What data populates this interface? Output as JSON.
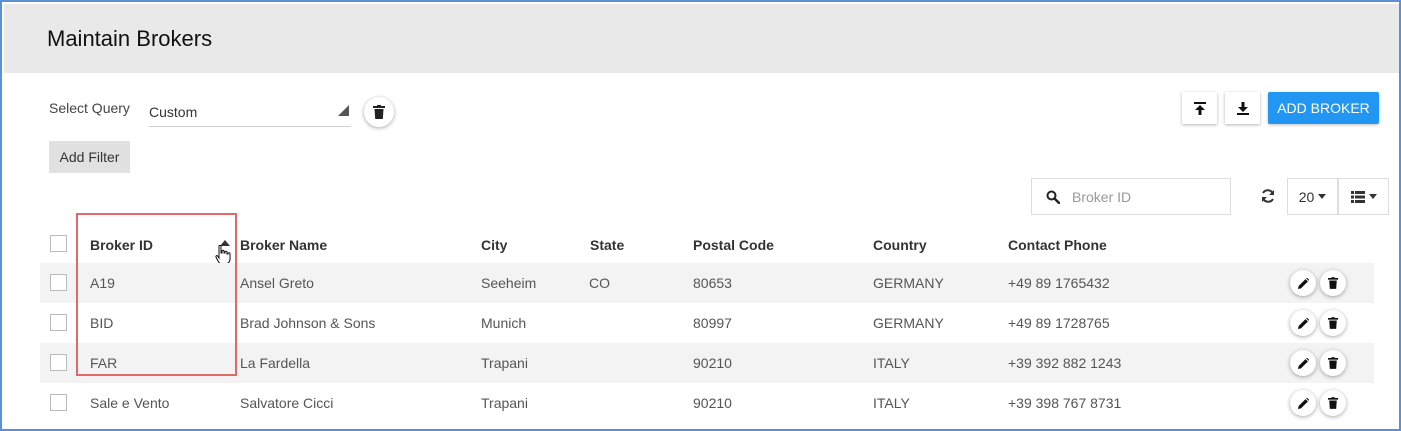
{
  "page": {
    "title": "Maintain Brokers"
  },
  "query": {
    "label": "Select Query",
    "value": "Custom"
  },
  "toolbar": {
    "add_filter_label": "Add Filter",
    "add_broker_label": "ADD BROKER"
  },
  "search": {
    "placeholder": "Broker ID",
    "value": ""
  },
  "pagination": {
    "page_size": "20"
  },
  "table": {
    "columns": [
      "Broker ID",
      "Broker Name",
      "City",
      "State",
      "Postal Code",
      "Country",
      "Contact Phone"
    ],
    "sort": {
      "column": "Broker ID",
      "direction": "ascending"
    },
    "rows": [
      {
        "broker_id": "A19",
        "broker_name": "Ansel Greto",
        "city": "Seeheim",
        "state": "CO",
        "postal_code": "80653",
        "country": "GERMANY",
        "phone": "+49 89 1765432"
      },
      {
        "broker_id": "BID",
        "broker_name": "Brad Johnson & Sons",
        "city": "Munich",
        "state": "",
        "postal_code": "80997",
        "country": "GERMANY",
        "phone": "+49 89 1728765"
      },
      {
        "broker_id": "FAR",
        "broker_name": "La Fardella",
        "city": "Trapani",
        "state": "",
        "postal_code": "90210",
        "country": "ITALY",
        "phone": "+39 392 882 1243"
      },
      {
        "broker_id": "Sale e Vento",
        "broker_name": "Salvatore Cicci",
        "city": "Trapani",
        "state": "",
        "postal_code": "90210",
        "country": "ITALY",
        "phone": "+39 398 767 8731"
      }
    ]
  },
  "icons": {
    "delete_query": "trash-icon",
    "upload": "upload-icon",
    "download": "download-icon",
    "search": "search-icon",
    "refresh": "refresh-icon",
    "columns": "list-icon",
    "edit": "pencil-icon",
    "delete_row": "trash-icon"
  },
  "colors": {
    "accent": "#2196f3",
    "highlight": "#e06a6a",
    "header_bg": "#e9e9e9",
    "frame": "#5b8fd6"
  }
}
